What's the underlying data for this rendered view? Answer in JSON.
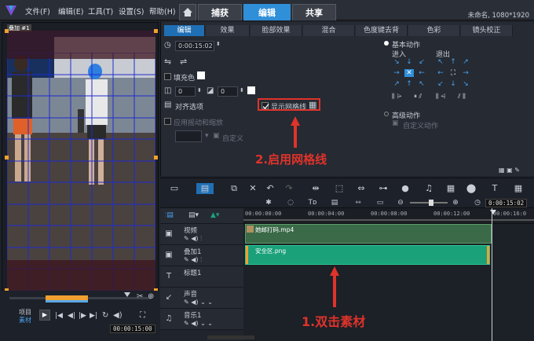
{
  "menu": {
    "items": [
      "文件(F)",
      "编辑(E)",
      "工具(T)",
      "设置(S)",
      "帮助(H)"
    ]
  },
  "tabs": {
    "capture": "捕获",
    "edit": "编辑",
    "share": "共享"
  },
  "project_info": "未命名, 1080*1920",
  "preview": {
    "label": "叠加 #1"
  },
  "player": {
    "project_label": "项目",
    "clip_label": "素材",
    "timecode": "00:00:15:00"
  },
  "options": {
    "tabs": [
      "编辑",
      "效果",
      "脸部效果",
      "混合",
      "色度键去背",
      "色彩",
      "镜头校正"
    ],
    "timecode": "0:00:15:02",
    "fill_color_label": "填充色",
    "value_a": "0",
    "value_b": "0",
    "align_options_label": "对齐选项",
    "show_grid_label": "显示网格线",
    "pan_zoom_label": "应用摇动和缩放",
    "custom_label": "自定义",
    "basic_motion_label": "基本动作",
    "enter_label": "进入",
    "exit_label": "退出",
    "advanced_motion_label": "高级动作",
    "custom_motion_label": "自定义动作"
  },
  "annotations": {
    "step2": "2.启用网格线",
    "step1": "1.双击素材"
  },
  "timeline": {
    "ruler_ticks": [
      "00:00:00:00",
      "00:00:04:00",
      "00:00:08:00",
      "00:00:12:00",
      "00:00:16:0"
    ],
    "tracks": [
      {
        "name": "视频",
        "icon": "video-track-icon"
      },
      {
        "name": "叠加1",
        "icon": "overlay-track-icon"
      },
      {
        "name": "标题1",
        "icon": "title-track-icon"
      },
      {
        "name": "声音",
        "icon": "voice-track-icon"
      },
      {
        "name": "音乐1",
        "icon": "music-track-icon"
      }
    ],
    "clips": {
      "video": "她邮打码.mp4",
      "overlay": "安全区.png"
    }
  },
  "colors": {
    "accent": "#2f8fd8",
    "annotation": "#e0332a",
    "overlay_clip": "#1aa17a",
    "video_clip": "#3a6a48",
    "grid_line": "#1f2bd0"
  }
}
